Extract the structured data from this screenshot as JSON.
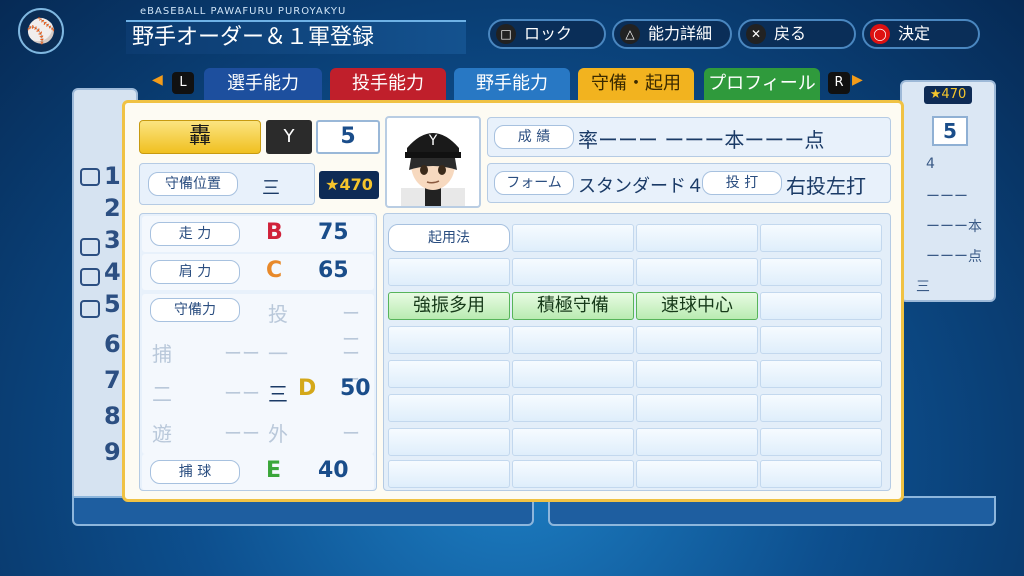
{
  "header": {
    "subtitle": "eBASEBALL PAWAFURU PUROYAKYU",
    "title": "野手オーダー＆１軍登録",
    "buttons": [
      {
        "icon": "square-icon",
        "glyph": "□",
        "label": "ロック"
      },
      {
        "icon": "triangle-icon",
        "glyph": "△",
        "label": "能力詳細"
      },
      {
        "icon": "cross-icon",
        "glyph": "✕",
        "label": "戻る"
      },
      {
        "icon": "circle-icon",
        "glyph": "◯",
        "label": "決定"
      }
    ]
  },
  "tabs": {
    "left_btn": "L",
    "right_btn": "R",
    "items": [
      "選手能力",
      "投手能力",
      "野手能力",
      "守備・起用",
      "プロフィール"
    ],
    "active": "守備・起用"
  },
  "side_left": {
    "numbers": [
      "1",
      "2",
      "3",
      "4",
      "5",
      "6",
      "7",
      "8",
      "9"
    ]
  },
  "side_right": {
    "cost": "★470",
    "number": "5",
    "rows": [
      "4",
      "ーーー",
      "ーーー本",
      "ーーー点",
      "三"
    ]
  },
  "player": {
    "name": "轟",
    "team_logo": "Y",
    "number": "5",
    "position_label": "守備位置",
    "position": "三",
    "cost": "★470",
    "record_label": "成 績",
    "record": "率ーーー ーーー本ーーー点",
    "form_label": "フォーム",
    "form": "スタンダード４５",
    "bat_label": "投 打",
    "bat": "右投左打"
  },
  "abilities": {
    "speed": {
      "label": "走 力",
      "rank": "B",
      "value": "75"
    },
    "arm": {
      "label": "肩 力",
      "rank": "C",
      "value": "65"
    },
    "defense_label": "守備力",
    "positions": [
      {
        "pos": "投",
        "value": "ーー"
      },
      {
        "pos": "捕",
        "value": "ーー"
      },
      {
        "pos": "一",
        "value": "ーー"
      },
      {
        "pos": "二",
        "value": "ーー"
      },
      {
        "pos": "三",
        "rank": "D",
        "value": "50"
      },
      {
        "pos": "遊",
        "value": "ーー"
      },
      {
        "pos": "外",
        "value": "ーー"
      }
    ],
    "catch": {
      "label": "捕 球",
      "rank": "E",
      "value": "40"
    }
  },
  "usage": {
    "header": "起用法",
    "strategies": [
      "強振多用",
      "積極守備",
      "速球中心"
    ]
  },
  "colors": {
    "rank_B": "#d0213a",
    "rank_C": "#e8892a",
    "rank_D": "#d4a81a",
    "rank_E": "#3aa63a",
    "accent_gold": "#f0c244"
  }
}
